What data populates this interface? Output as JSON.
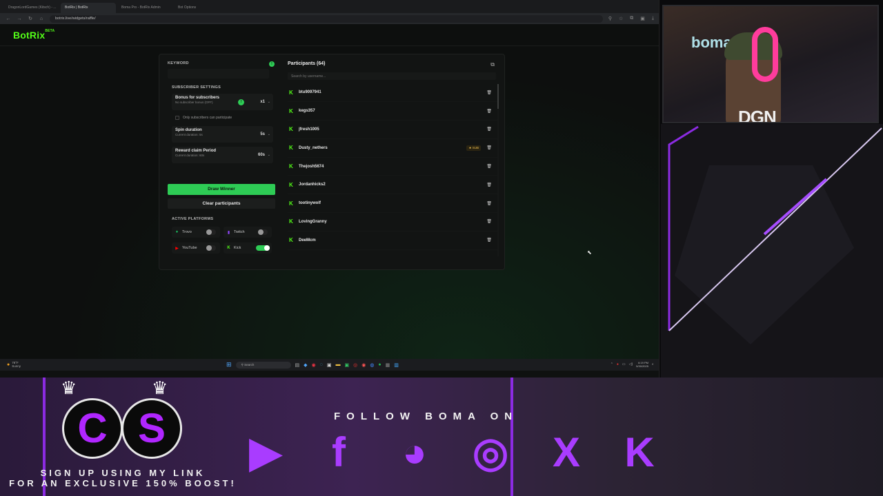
{
  "browser": {
    "tabs": [
      "DragonLordGames (Kitsch) - ...",
      "BotRix | BotRix",
      "Boma Pro - BotRix Admin",
      "Bot Options"
    ],
    "url": "botrix.live/widgets/raffle/"
  },
  "app": {
    "brand": "BotRix",
    "brand_badge": "BETA",
    "accent_color": "#53fc18",
    "button_color": "#2ecc55"
  },
  "raffle": {
    "keyword_label": "KEYWORD",
    "keyword_value": "",
    "subscriber_settings_label": "SUBSCRIBER SETTINGS",
    "bonus": {
      "title": "Bonus for subscribers",
      "sub": "No subscriber bonus (OFF)",
      "value": "x1"
    },
    "only_subs_label": "Only subscribers can participate",
    "spin": {
      "title": "Spin duration",
      "sub": "Current duration: 5s",
      "value": "5s"
    },
    "reward": {
      "title": "Reward claim Period",
      "sub": "Current duration: 60s",
      "value": "60s"
    },
    "draw_button": "Draw Winner",
    "clear_button": "Clear participants",
    "platforms_label": "ACTIVE PLATFORMS",
    "platforms": [
      {
        "name": "Trovo",
        "enabled": false,
        "icon": "trovo-icon",
        "color": "#19d66b"
      },
      {
        "name": "Twitch",
        "enabled": false,
        "icon": "twitch-icon",
        "color": "#9146ff"
      },
      {
        "name": "YouTube",
        "enabled": false,
        "icon": "youtube-icon",
        "color": "#ff0000"
      },
      {
        "name": "Kick",
        "enabled": true,
        "icon": "kick-icon",
        "color": "#53fc18"
      }
    ]
  },
  "participants": {
    "title": "Participants (64)",
    "search_placeholder": "Search by username...",
    "list": [
      {
        "name": "btu9097941",
        "sub": false
      },
      {
        "name": "kegs357",
        "sub": false
      },
      {
        "name": "jfresh1005",
        "sub": false
      },
      {
        "name": "Dusty_nethers",
        "sub": true
      },
      {
        "name": "Thejosh5674",
        "sub": false
      },
      {
        "name": "Jordanhicks2",
        "sub": false
      },
      {
        "name": "tootinywolf",
        "sub": false
      },
      {
        "name": "LovingGranny",
        "sub": false
      },
      {
        "name": "DeeMcm",
        "sub": false
      }
    ],
    "sub_badge": "★ SUB"
  },
  "taskbar": {
    "weather_temp": "78°F",
    "weather_desc": "Sunny",
    "search": "Search",
    "time": "6:19 PM",
    "date": "5/30/2025"
  },
  "overlay": {
    "webcam_neon": "boma",
    "webcam_tag": "DGN",
    "cs_letters": [
      "C",
      "S"
    ],
    "signup_line1": "SIGN UP USING MY LINK",
    "signup_line2": "FOR AN EXCLUSIVE 150% BOOST!",
    "follow_text": "FOLLOW BOMA ON",
    "socials": [
      "youtube-icon",
      "facebook-icon",
      "discord-icon",
      "instagram-icon",
      "x-icon",
      "kick-icon"
    ]
  }
}
